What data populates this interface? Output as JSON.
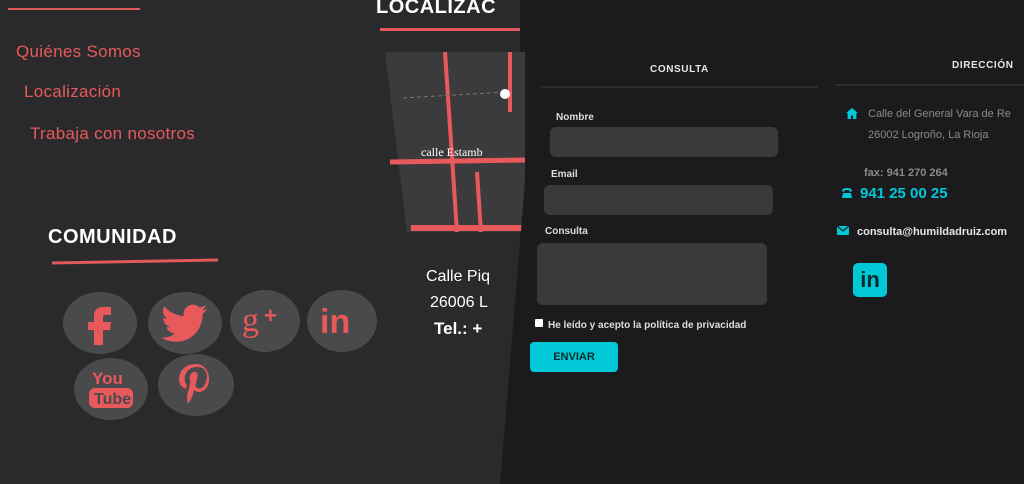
{
  "menu": {
    "items": [
      "Quiénes Somos",
      "Localización",
      "Trabaja con nosotros"
    ]
  },
  "community": {
    "title": "COMUNIDAD",
    "social": [
      "facebook-icon",
      "twitter-icon",
      "google-plus-icon",
      "linkedin-icon",
      "youtube-icon",
      "pinterest-icon"
    ]
  },
  "location": {
    "title": "LOCALIZAC",
    "map_street": "calle Estamb",
    "address_line1": "Calle Piq",
    "address_line2": "26006 L",
    "phone": "Tel.: +"
  },
  "form": {
    "header": "CONSULTA",
    "name_label": "Nombre",
    "email_label": "Email",
    "query_label": "Consulta",
    "privacy_label": "He leído y acepto la política de privacidad",
    "submit_label": "ENVIAR"
  },
  "address": {
    "header": "DIRECCIÓN",
    "street": "Calle del General Vara de Re",
    "city": "26002 Logroño, La Rioja",
    "fax": "fax: 941 270 264",
    "phone": "941 25 00 25",
    "email": "consulta@humildadruiz.com"
  },
  "colors": {
    "accent_red": "#e8595b",
    "accent_cyan": "#00c8d6",
    "panel_dark": "#1b1b1d",
    "panel_left": "#2a2a2c"
  }
}
